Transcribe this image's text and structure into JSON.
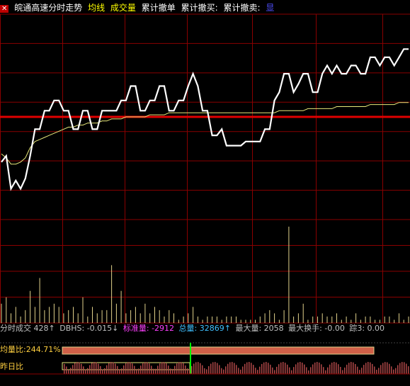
{
  "header": {
    "close_glyph": "✕",
    "title": "皖通高速分时走势",
    "avg_label": "均线",
    "volume_label": "成交量",
    "cum_cancel_orders": "累计撤单",
    "cum_cancel_buy": "累计撤买:",
    "cum_cancel_sell": "累计撤卖:",
    "badge": "显"
  },
  "stats": {
    "tick_volume": "分时成交 428↑",
    "dbhs": "DBHS: -0.015↓",
    "std_volume": "标准量: -2912",
    "total_volume": "总量: 32869↑",
    "max_volume": "最大量: 2058",
    "max_turnover": "最大换手: -0.00",
    "trace3": "踪3: 0.00"
  },
  "bottom": {
    "volume_ratio_label": "均量比:244.71%",
    "prev_day_ratio_label": "昨日比"
  },
  "colors": {
    "background": "#000000",
    "grid": "#8a0000",
    "price_line": "#ffffff",
    "avg_line": "#e8e87a",
    "prev_close": "#e00000",
    "volume_bar": "#e0d08a",
    "ratio_bar": "#d06048",
    "title_text": "#ffffff",
    "accent_text": "#ffff00"
  },
  "chart_data": {
    "type": "line",
    "series": [
      {
        "values": [
          0.28,
          0.31,
          0.15,
          0.19,
          0.15,
          0.2,
          0.31,
          0.44,
          0.44,
          0.53,
          0.53,
          0.58,
          0.58,
          0.53,
          0.53,
          0.44,
          0.44,
          0.53,
          0.53,
          0.44,
          0.44,
          0.53,
          0.53,
          0.53,
          0.53,
          0.58,
          0.58,
          0.65,
          0.65,
          0.53,
          0.53,
          0.58,
          0.58,
          0.65,
          0.65,
          0.53,
          0.53,
          0.58,
          0.58,
          0.65,
          0.71,
          0.65,
          0.53,
          0.53,
          0.41,
          0.41,
          0.44,
          0.36,
          0.36,
          0.36,
          0.36,
          0.38,
          0.38,
          0.38,
          0.38,
          0.44,
          0.44,
          0.58,
          0.62,
          0.71,
          0.71,
          0.62,
          0.66,
          0.71,
          0.71,
          0.62,
          0.62,
          0.71,
          0.75,
          0.71,
          0.75,
          0.71,
          0.71,
          0.75,
          0.75,
          0.71,
          0.71,
          0.79,
          0.79,
          0.75,
          0.79,
          0.79,
          0.75,
          0.79,
          0.83,
          0.83
        ]
      },
      {
        "values": [
          0.32,
          0.3,
          0.27,
          0.27,
          0.28,
          0.3,
          0.35,
          0.38,
          0.39,
          0.4,
          0.41,
          0.42,
          0.43,
          0.44,
          0.45,
          0.45,
          0.46,
          0.46,
          0.47,
          0.47,
          0.47,
          0.48,
          0.48,
          0.49,
          0.49,
          0.49,
          0.5,
          0.5,
          0.5,
          0.5,
          0.5,
          0.51,
          0.51,
          0.51,
          0.51,
          0.52,
          0.52,
          0.52,
          0.52,
          0.52,
          0.52,
          0.52,
          0.52,
          0.52,
          0.52,
          0.52,
          0.52,
          0.52,
          0.52,
          0.52,
          0.52,
          0.52,
          0.52,
          0.52,
          0.52,
          0.52,
          0.52,
          0.52,
          0.53,
          0.53,
          0.53,
          0.53,
          0.53,
          0.53,
          0.54,
          0.54,
          0.54,
          0.54,
          0.54,
          0.54,
          0.55,
          0.55,
          0.55,
          0.55,
          0.55,
          0.55,
          0.55,
          0.56,
          0.56,
          0.56,
          0.56,
          0.56,
          0.56,
          0.57,
          0.57,
          0.57
        ]
      }
    ],
    "volume": [
      6,
      8,
      3,
      5,
      2,
      4,
      10,
      5,
      14,
      4,
      5,
      6,
      5,
      3,
      4,
      5,
      3,
      8,
      2,
      5,
      3,
      4,
      4,
      18,
      6,
      10,
      3,
      4,
      5,
      3,
      6,
      3,
      5,
      4,
      2,
      4,
      3,
      1,
      2,
      3,
      5,
      2,
      1,
      2,
      2,
      2,
      1,
      2,
      2,
      2,
      1,
      1,
      1,
      1,
      2,
      3,
      4,
      3,
      1,
      4,
      30,
      2,
      3,
      6,
      1,
      2,
      2,
      3,
      2,
      2,
      3,
      1,
      2,
      1,
      3,
      1,
      2,
      2,
      1,
      1,
      2,
      2,
      1,
      3,
      1,
      2
    ],
    "prev_close_level": 0.5,
    "ylim": [
      0,
      1
    ]
  }
}
